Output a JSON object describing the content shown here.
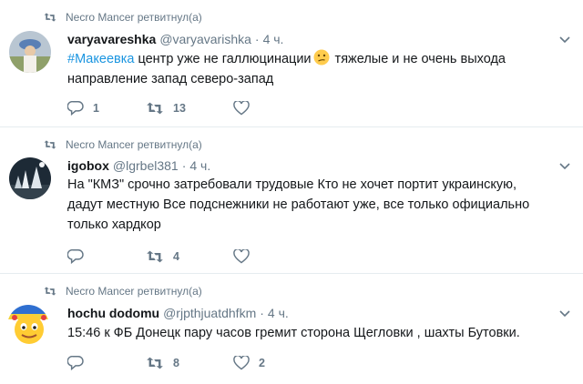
{
  "tweets": [
    {
      "retweeted_by": "Necro Mancer ретвитнул(а)",
      "name": "varyavareshka",
      "handle": "@varyavarishka",
      "sep": "·",
      "time": "4 ч.",
      "text_hashtag": "#Макеевка",
      "text_line1_rest": " центр  уже не галлюцинации",
      "text_line1_after_emoji": " тяжелые и не очень выхода",
      "text_line2": "направление запад северо-запад",
      "emoji": "confused-face",
      "reply_count": "1",
      "retweet_count": "13",
      "like_count": ""
    },
    {
      "retweeted_by": "Necro Mancer ретвитнул(а)",
      "name": "igobox",
      "handle": "@lgrbel381",
      "sep": "·",
      "time": "4 ч.",
      "text_line1": "На \"КМЗ\" срочно затребовали трудовые Кто не хочет портит украинскую,",
      "text_line2": "дадут местную Все подснежники не работают уже, все только официально",
      "text_line3": "только хардкор",
      "reply_count": "",
      "retweet_count": "4",
      "like_count": ""
    },
    {
      "retweeted_by": "Necro Mancer ретвитнул(а)",
      "name": "hochu dodomu",
      "handle": "@rjpthjuatdhfkm",
      "sep": "·",
      "time": "4 ч.",
      "text_line1": "15:46 к ФБ Донецк  пару часов гремит сторона Щегловки , шахты Бутовки.",
      "reply_count": "",
      "retweet_count": "8",
      "like_count": "2"
    }
  ],
  "colors": {
    "text": "#14171a",
    "muted": "#657786",
    "link": "#1b95e0",
    "divider": "#e6ecf0"
  }
}
